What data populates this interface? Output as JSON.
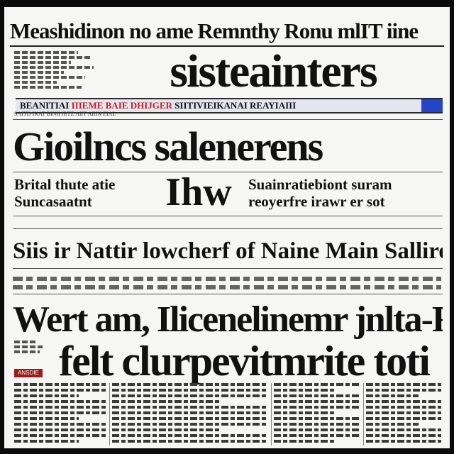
{
  "masthead": {
    "top_line": "Meashidinon no ame Remnthy Ronu mlIT iine",
    "nameplate": "sisteainters"
  },
  "banner": {
    "text_left": "BEANITIAI",
    "text_red": "IIIEME BAIE DHIJGER",
    "text_right": "SIITIVIEIKANAI REAYIAIII",
    "accent_color": "#c0201f",
    "block_color": "#2546c9"
  },
  "sub_columns": "SAITD    IKAT    BINII    IBTZ    AIIT    AIIIN    EIAL",
  "headline_1": "Gioilncs salenerens",
  "deck": {
    "left_line_1": "Brital thute atie",
    "left_line_2": "Suncasaatnt",
    "center": "Ihw",
    "right_line_1": "Suainratiebiont suram",
    "right_line_2": "reoyerfre irawr er sot"
  },
  "headline_3": "Siis ir Nattir lowcherf of Naine Main Sallire",
  "headline_4": "Wert am, Ilicenelinemr jnlta-Ram",
  "headline_5": "felt clurpevitmrite toti",
  "tag": "ANSDIE"
}
